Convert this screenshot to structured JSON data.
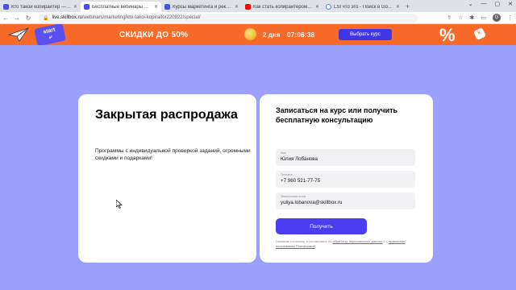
{
  "browser": {
    "tabs": [
      {
        "title": "Кто такой копирайтер — бесп...",
        "favicon": "skillbox-icon",
        "active": false
      },
      {
        "title": "Бесплатные вебинары и курсы...",
        "favicon": "skillbox-icon",
        "active": true
      },
      {
        "title": "Курсы маркетинга и рекламы ...",
        "favicon": "skillbox-icon",
        "active": false
      },
      {
        "title": "Как стать копирайтером с нуля...",
        "favicon": "youtube-icon",
        "active": false
      },
      {
        "title": "LSI что это - Поиск в Google",
        "favicon": "google-icon",
        "active": false
      }
    ],
    "url_host": "live.skillbox.ru",
    "url_path": "/webinars/marketing/kto-takoi-kopiraitor220922/special/",
    "profile_initial": "G"
  },
  "promo": {
    "start_label": "start",
    "sale_text": "СКИДКИ ДО 50%",
    "days_left": "2 дня",
    "timer": "07:06:38",
    "cta_label": "Выбрать курс",
    "percent_sign": "%",
    "background_color": "#f76a2a",
    "cta_color": "#4136e6"
  },
  "left_card": {
    "title": "Закрытая распродажа",
    "description": "Программы с индивидуальной проверкой заданий, огромными скидками и подарками!"
  },
  "form": {
    "heading": "Записаться на курс или получить бесплатную консультацию",
    "fields": [
      {
        "label": "Имя",
        "value": "Юлия Лобанова"
      },
      {
        "label": "Телефон",
        "value": "+7 960 521-77-75"
      },
      {
        "label": "Электронная почта",
        "value": "yuliya.lobanova@skillbox.ru"
      }
    ],
    "submit_label": "Получить",
    "legal_prefix": "Нажимая на кнопку, я соглашаюсь на ",
    "legal_link1": "обработку персональных данных",
    "legal_middle": " и с ",
    "legal_link2": "правилами пользования Платформой",
    "submit_color": "#4b3df0"
  },
  "page": {
    "background_color": "#9aa0fb"
  }
}
